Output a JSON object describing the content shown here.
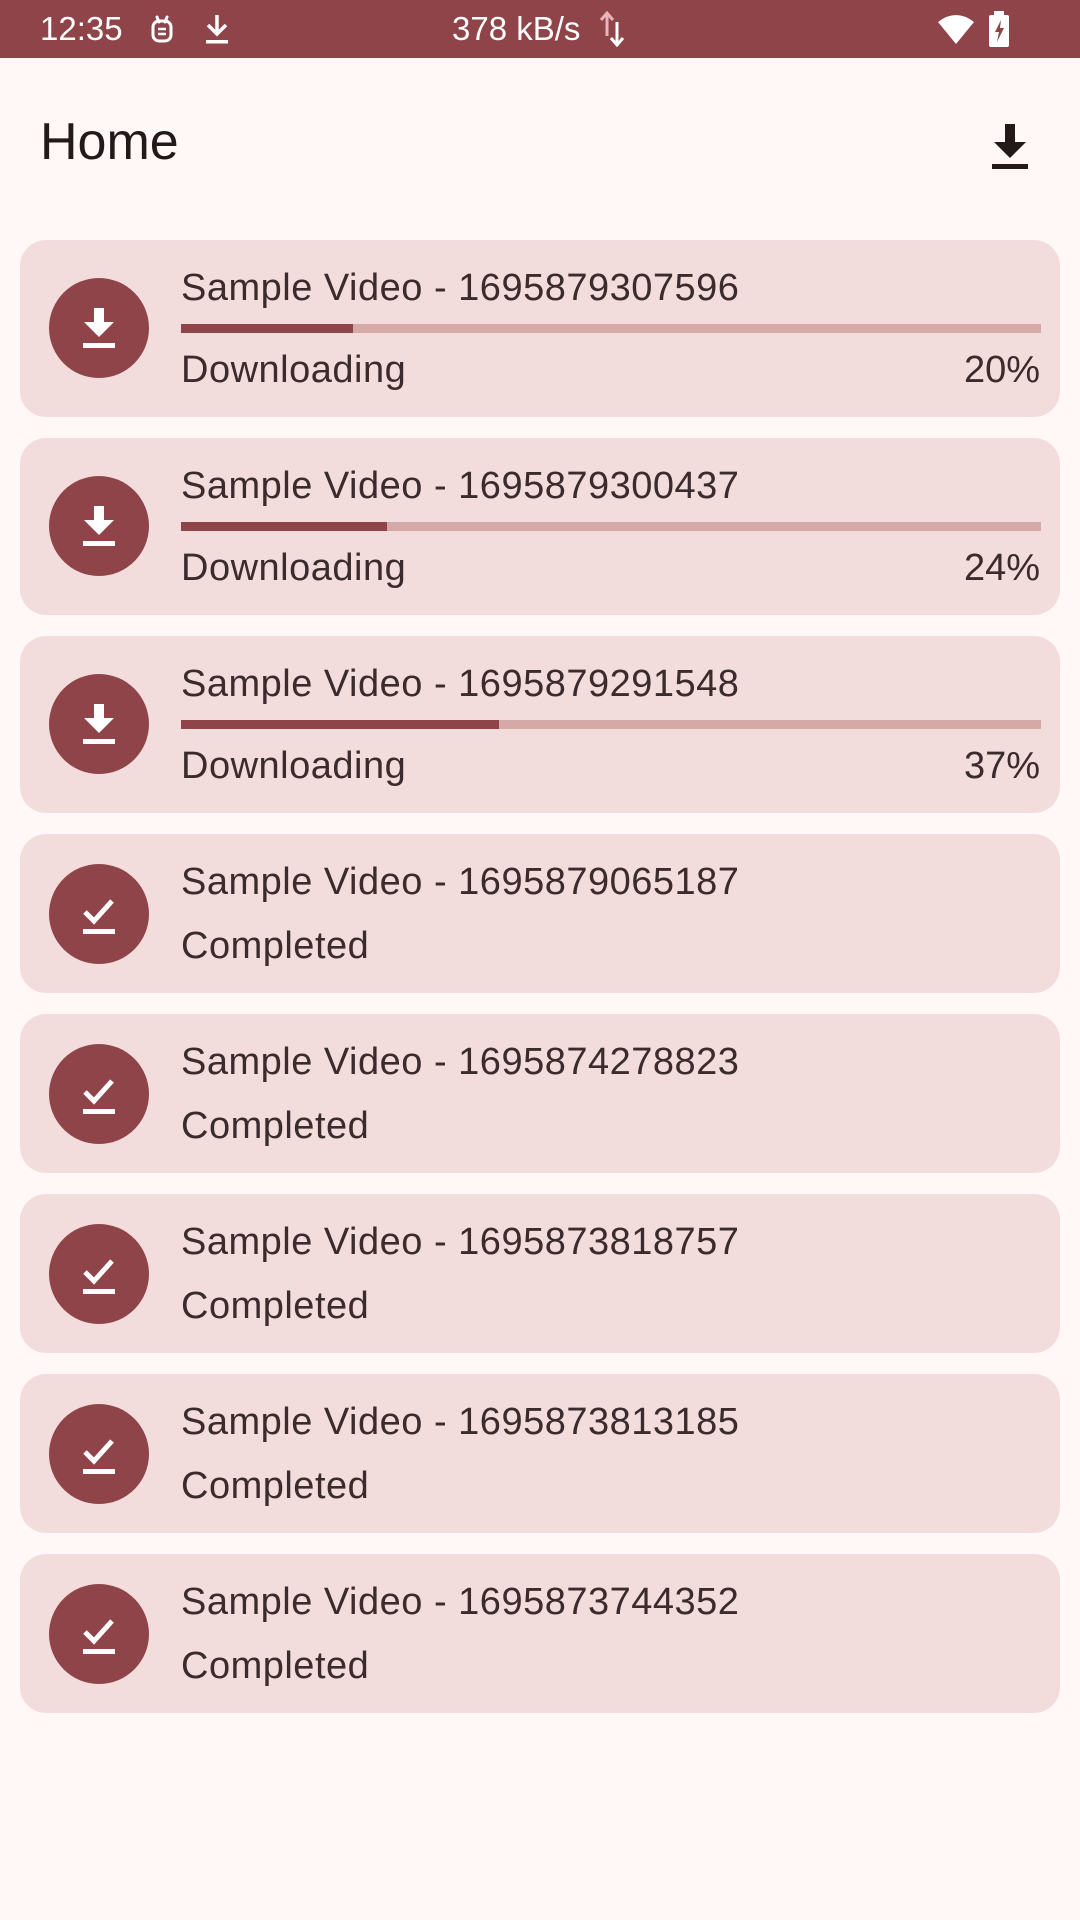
{
  "status_bar": {
    "time": "12:35",
    "network_speed": "378 kB/s",
    "background_color": "#8f4449",
    "icons": [
      "notification-app-icon",
      "download-notification-icon",
      "data-transfer-icon",
      "wifi-icon",
      "battery-charging-icon"
    ]
  },
  "app_bar": {
    "title": "Home",
    "action_icon": "download-icon"
  },
  "colors": {
    "accent": "#8f4449",
    "card_background": "#f3dddc",
    "track": "#d6a9a9",
    "page_background": "#fff8f7"
  },
  "downloads": [
    {
      "title": "Sample Video - 1695879307596",
      "status": "Downloading",
      "percent_label": "20%",
      "progress": 0.2,
      "icon": "download-icon"
    },
    {
      "title": "Sample Video - 1695879300437",
      "status": "Downloading",
      "percent_label": "24%",
      "progress": 0.24,
      "icon": "download-icon"
    },
    {
      "title": "Sample Video - 1695879291548",
      "status": "Downloading",
      "percent_label": "37%",
      "progress": 0.37,
      "icon": "download-icon"
    },
    {
      "title": "Sample Video - 1695879065187",
      "status": "Completed",
      "icon": "download-done-icon"
    },
    {
      "title": "Sample Video - 1695874278823",
      "status": "Completed",
      "icon": "download-done-icon"
    },
    {
      "title": "Sample Video - 1695873818757",
      "status": "Completed",
      "icon": "download-done-icon"
    },
    {
      "title": "Sample Video - 1695873813185",
      "status": "Completed",
      "icon": "download-done-icon"
    },
    {
      "title": "Sample Video - 1695873744352",
      "status": "Completed",
      "icon": "download-done-icon"
    }
  ]
}
